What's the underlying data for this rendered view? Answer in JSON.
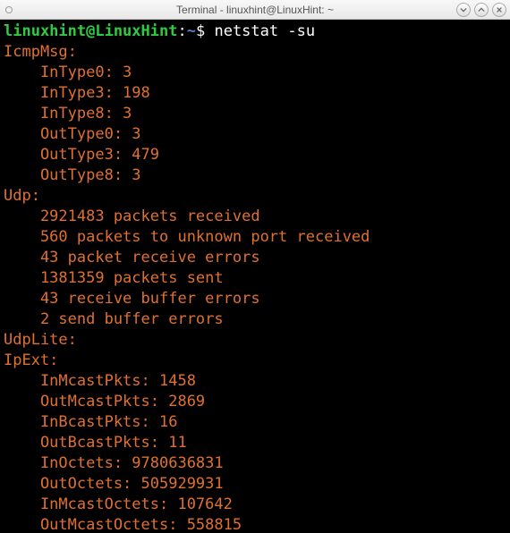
{
  "window": {
    "title": "Terminal - linuxhint@LinuxHint: ~"
  },
  "prompt": {
    "user_host": "linuxhint@LinuxHint",
    "colon": ":",
    "path": "~",
    "dollar": "$",
    "command": "netstat -su"
  },
  "output": {
    "icmp_header": "IcmpMsg:",
    "icmp_intype0": "    InType0: 3",
    "icmp_intype3": "    InType3: 198",
    "icmp_intype8": "    InType8: 3",
    "icmp_outtype0": "    OutType0: 3",
    "icmp_outtype3": "    OutType3: 479",
    "icmp_outtype8": "    OutType8: 3",
    "udp_header": "Udp:",
    "udp_recv": "    2921483 packets received",
    "udp_unknown": "    560 packets to unknown port received",
    "udp_recv_err": "    43 packet receive errors",
    "udp_sent": "    1381359 packets sent",
    "udp_buf_err": "    43 receive buffer errors",
    "udp_send_buf_err": "    2 send buffer errors",
    "udplite_header": "UdpLite:",
    "ipext_header": "IpExt:",
    "ipext_inmcast": "    InMcastPkts: 1458",
    "ipext_outmcast": "    OutMcastPkts: 2869",
    "ipext_inbcast": "    InBcastPkts: 16",
    "ipext_outbcast": "    OutBcastPkts: 11",
    "ipext_inoctets": "    InOctets: 9780636831",
    "ipext_outoctets": "    OutOctets: 505929931",
    "ipext_inmcastoct": "    InMcastOctets: 107642",
    "ipext_outmcastoct": "    OutMcastOctets: 558815"
  }
}
